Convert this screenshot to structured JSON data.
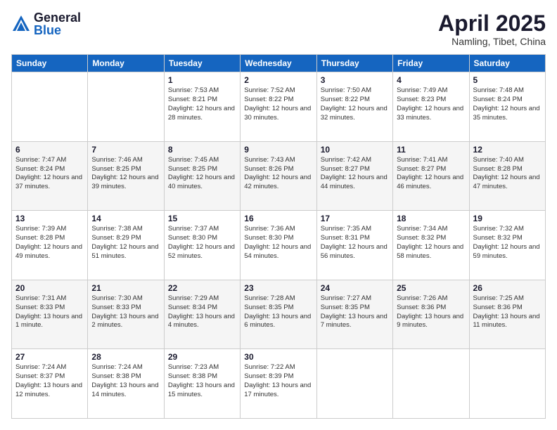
{
  "logo": {
    "general": "General",
    "blue": "Blue"
  },
  "title": {
    "month": "April 2025",
    "location": "Namling, Tibet, China"
  },
  "weekdays": [
    "Sunday",
    "Monday",
    "Tuesday",
    "Wednesday",
    "Thursday",
    "Friday",
    "Saturday"
  ],
  "weeks": [
    [
      null,
      null,
      {
        "day": "1",
        "sunrise": "Sunrise: 7:53 AM",
        "sunset": "Sunset: 8:21 PM",
        "daylight": "Daylight: 12 hours and 28 minutes."
      },
      {
        "day": "2",
        "sunrise": "Sunrise: 7:52 AM",
        "sunset": "Sunset: 8:22 PM",
        "daylight": "Daylight: 12 hours and 30 minutes."
      },
      {
        "day": "3",
        "sunrise": "Sunrise: 7:50 AM",
        "sunset": "Sunset: 8:22 PM",
        "daylight": "Daylight: 12 hours and 32 minutes."
      },
      {
        "day": "4",
        "sunrise": "Sunrise: 7:49 AM",
        "sunset": "Sunset: 8:23 PM",
        "daylight": "Daylight: 12 hours and 33 minutes."
      },
      {
        "day": "5",
        "sunrise": "Sunrise: 7:48 AM",
        "sunset": "Sunset: 8:24 PM",
        "daylight": "Daylight: 12 hours and 35 minutes."
      }
    ],
    [
      {
        "day": "6",
        "sunrise": "Sunrise: 7:47 AM",
        "sunset": "Sunset: 8:24 PM",
        "daylight": "Daylight: 12 hours and 37 minutes."
      },
      {
        "day": "7",
        "sunrise": "Sunrise: 7:46 AM",
        "sunset": "Sunset: 8:25 PM",
        "daylight": "Daylight: 12 hours and 39 minutes."
      },
      {
        "day": "8",
        "sunrise": "Sunrise: 7:45 AM",
        "sunset": "Sunset: 8:25 PM",
        "daylight": "Daylight: 12 hours and 40 minutes."
      },
      {
        "day": "9",
        "sunrise": "Sunrise: 7:43 AM",
        "sunset": "Sunset: 8:26 PM",
        "daylight": "Daylight: 12 hours and 42 minutes."
      },
      {
        "day": "10",
        "sunrise": "Sunrise: 7:42 AM",
        "sunset": "Sunset: 8:27 PM",
        "daylight": "Daylight: 12 hours and 44 minutes."
      },
      {
        "day": "11",
        "sunrise": "Sunrise: 7:41 AM",
        "sunset": "Sunset: 8:27 PM",
        "daylight": "Daylight: 12 hours and 46 minutes."
      },
      {
        "day": "12",
        "sunrise": "Sunrise: 7:40 AM",
        "sunset": "Sunset: 8:28 PM",
        "daylight": "Daylight: 12 hours and 47 minutes."
      }
    ],
    [
      {
        "day": "13",
        "sunrise": "Sunrise: 7:39 AM",
        "sunset": "Sunset: 8:28 PM",
        "daylight": "Daylight: 12 hours and 49 minutes."
      },
      {
        "day": "14",
        "sunrise": "Sunrise: 7:38 AM",
        "sunset": "Sunset: 8:29 PM",
        "daylight": "Daylight: 12 hours and 51 minutes."
      },
      {
        "day": "15",
        "sunrise": "Sunrise: 7:37 AM",
        "sunset": "Sunset: 8:30 PM",
        "daylight": "Daylight: 12 hours and 52 minutes."
      },
      {
        "day": "16",
        "sunrise": "Sunrise: 7:36 AM",
        "sunset": "Sunset: 8:30 PM",
        "daylight": "Daylight: 12 hours and 54 minutes."
      },
      {
        "day": "17",
        "sunrise": "Sunrise: 7:35 AM",
        "sunset": "Sunset: 8:31 PM",
        "daylight": "Daylight: 12 hours and 56 minutes."
      },
      {
        "day": "18",
        "sunrise": "Sunrise: 7:34 AM",
        "sunset": "Sunset: 8:32 PM",
        "daylight": "Daylight: 12 hours and 58 minutes."
      },
      {
        "day": "19",
        "sunrise": "Sunrise: 7:32 AM",
        "sunset": "Sunset: 8:32 PM",
        "daylight": "Daylight: 12 hours and 59 minutes."
      }
    ],
    [
      {
        "day": "20",
        "sunrise": "Sunrise: 7:31 AM",
        "sunset": "Sunset: 8:33 PM",
        "daylight": "Daylight: 13 hours and 1 minute."
      },
      {
        "day": "21",
        "sunrise": "Sunrise: 7:30 AM",
        "sunset": "Sunset: 8:33 PM",
        "daylight": "Daylight: 13 hours and 2 minutes."
      },
      {
        "day": "22",
        "sunrise": "Sunrise: 7:29 AM",
        "sunset": "Sunset: 8:34 PM",
        "daylight": "Daylight: 13 hours and 4 minutes."
      },
      {
        "day": "23",
        "sunrise": "Sunrise: 7:28 AM",
        "sunset": "Sunset: 8:35 PM",
        "daylight": "Daylight: 13 hours and 6 minutes."
      },
      {
        "day": "24",
        "sunrise": "Sunrise: 7:27 AM",
        "sunset": "Sunset: 8:35 PM",
        "daylight": "Daylight: 13 hours and 7 minutes."
      },
      {
        "day": "25",
        "sunrise": "Sunrise: 7:26 AM",
        "sunset": "Sunset: 8:36 PM",
        "daylight": "Daylight: 13 hours and 9 minutes."
      },
      {
        "day": "26",
        "sunrise": "Sunrise: 7:25 AM",
        "sunset": "Sunset: 8:36 PM",
        "daylight": "Daylight: 13 hours and 11 minutes."
      }
    ],
    [
      {
        "day": "27",
        "sunrise": "Sunrise: 7:24 AM",
        "sunset": "Sunset: 8:37 PM",
        "daylight": "Daylight: 13 hours and 12 minutes."
      },
      {
        "day": "28",
        "sunrise": "Sunrise: 7:24 AM",
        "sunset": "Sunset: 8:38 PM",
        "daylight": "Daylight: 13 hours and 14 minutes."
      },
      {
        "day": "29",
        "sunrise": "Sunrise: 7:23 AM",
        "sunset": "Sunset: 8:38 PM",
        "daylight": "Daylight: 13 hours and 15 minutes."
      },
      {
        "day": "30",
        "sunrise": "Sunrise: 7:22 AM",
        "sunset": "Sunset: 8:39 PM",
        "daylight": "Daylight: 13 hours and 17 minutes."
      },
      null,
      null,
      null
    ]
  ]
}
